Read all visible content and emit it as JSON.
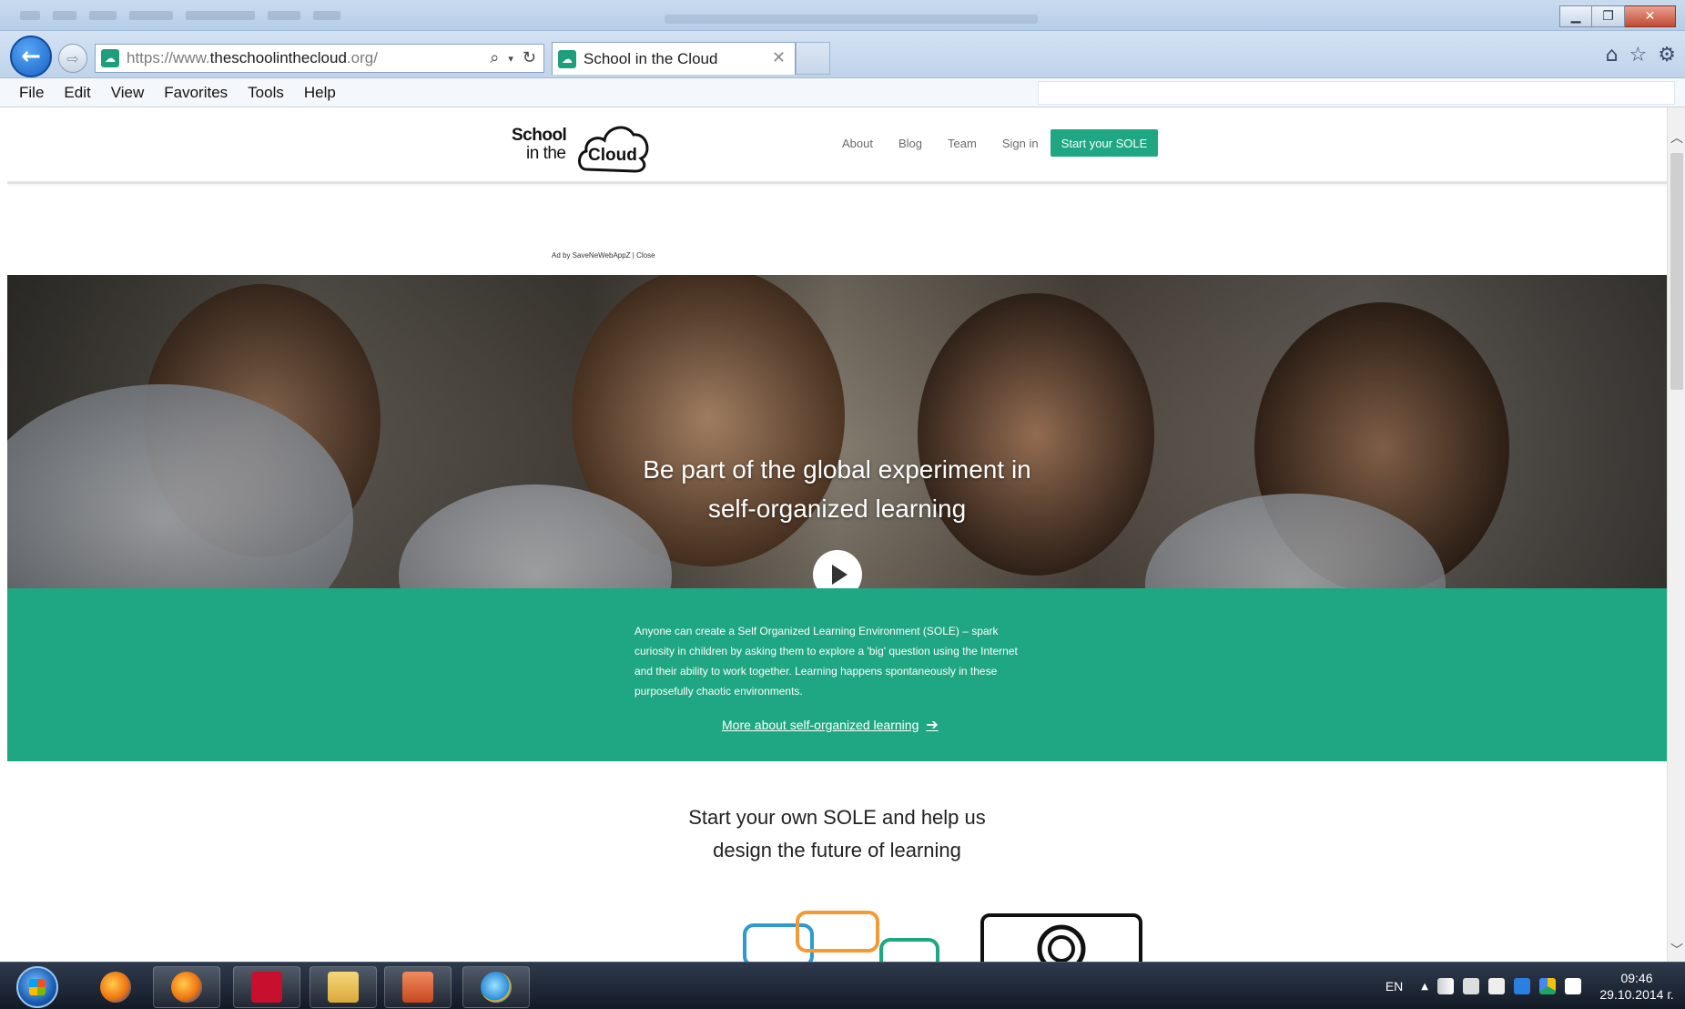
{
  "browser": {
    "address_url_prefix": "https://www.",
    "address_url_domain": "theschoolinthecloud",
    "address_url_suffix": ".org/",
    "tab_title": "School in the Cloud",
    "menu": [
      "File",
      "Edit",
      "View",
      "Favorites",
      "Tools",
      "Help"
    ]
  },
  "site": {
    "logo_school": "School",
    "logo_inthe": "in the",
    "logo_cloud": "Cloud",
    "nav": [
      "About",
      "Blog",
      "Team",
      "Sign in"
    ],
    "cta_label": "Start your SOLE",
    "ad_line": "Ad by SaveNeWebAppZ | Close",
    "hero_line1": "Be part of the global experiment in",
    "hero_line2": "self-organized learning",
    "band_text": "Anyone can create a Self Organized Learning Environment (SOLE) – spark curiosity in children by asking them to explore a 'big' question using the Internet and their ability to work together. Learning happens spontaneously in these purposefully chaotic environments.",
    "band_link": "More about self-organized learning",
    "start_line1": "Start your own SOLE and help us",
    "start_line2": "design the future of learning",
    "brand_color": "#1fa783"
  },
  "taskbar": {
    "lang": "EN",
    "time": "09:46",
    "date": "29.10.2014 г."
  }
}
